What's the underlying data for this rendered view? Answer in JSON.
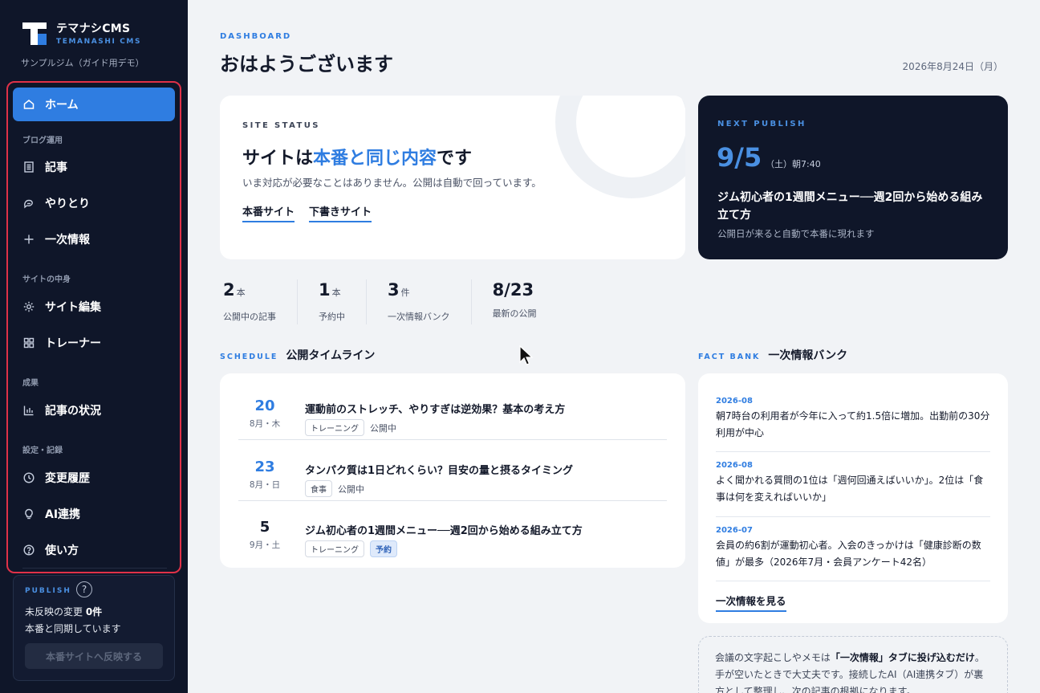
{
  "brand": {
    "name": "テマナシCMS",
    "sub": "TEMANASHI CMS",
    "site_name": "サンプルジム（ガイド用デモ）"
  },
  "sidebar": {
    "home": "ホーム",
    "groups": [
      "ブログ運用",
      "サイトの中身",
      "成果",
      "設定・記録"
    ],
    "items": [
      {
        "label": "記事",
        "icon": "document-icon"
      },
      {
        "label": "やりとり",
        "icon": "chat-icon"
      },
      {
        "label": "一次情報",
        "icon": "plus-icon"
      },
      {
        "label": "サイト編集",
        "icon": "gear-icon"
      },
      {
        "label": "トレーナー",
        "icon": "grid-icon"
      },
      {
        "label": "記事の状況",
        "icon": "bar-chart-icon"
      },
      {
        "label": "変更履歴",
        "icon": "clock-icon"
      },
      {
        "label": "AI連携",
        "icon": "lightbulb-icon"
      },
      {
        "label": "使い方",
        "icon": "help-icon"
      }
    ],
    "accent_color": "#2f7de1",
    "highlight_frame_color": "#e03148"
  },
  "publish": {
    "label": "PUBLISH",
    "help": "?",
    "pending_prefix": "未反映の変更 ",
    "pending_count": "0件",
    "sync_status": "本番と同期しています",
    "button": "本番サイトへ反映する"
  },
  "header": {
    "eyebrow": "DASHBOARD",
    "greeting": "おはようございます",
    "date": "2026年8月24日（月）"
  },
  "site_status": {
    "eyebrow": "SITE STATUS",
    "title_pre": "サイトは",
    "title_hl": "本番と同じ内容",
    "title_post": "です",
    "desc": "いま対応が必要なことはありません。公開は自動で回っています。",
    "link_prod": "本番サイト",
    "link_draft": "下書きサイト"
  },
  "next_publish": {
    "eyebrow": "NEXT PUBLISH",
    "date": "9/5",
    "when": "（土）朝7:40",
    "title": "ジム初心者の1週間メニュー──週2回から始める組み立て方",
    "note": "公開日が来ると自動で本番に現れます"
  },
  "stats": [
    {
      "num": "2",
      "unit": "本",
      "label": "公開中の記事"
    },
    {
      "num": "1",
      "unit": "本",
      "label": "予約中"
    },
    {
      "num": "3",
      "unit": "件",
      "label": "一次情報バンク"
    },
    {
      "num": "8/23",
      "unit": "",
      "label": "最新の公開"
    }
  ],
  "schedule": {
    "eyebrow": "SCHEDULE",
    "title": "公開タイムライン",
    "rows": [
      {
        "day": "20",
        "md": "8月・木",
        "title": "運動前のストレッチ、やりすぎは逆効果？基本の考え方",
        "tag": "トレーニング",
        "state": "公開中"
      },
      {
        "day": "23",
        "md": "8月・日",
        "title": "タンパク質は1日どれくらい？目安の量と摂るタイミング",
        "tag": "食事",
        "state": "公開中"
      },
      {
        "day": "5",
        "md": "9月・土",
        "title": "ジム初心者の1週間メニュー──週2回から始める組み立て方",
        "tag": "トレーニング",
        "state": "予約"
      }
    ]
  },
  "fact_bank": {
    "eyebrow": "FACT BANK",
    "title": "一次情報バンク",
    "facts": [
      {
        "date": "2026-08",
        "text": "朝7時台の利用者が今年に入って約1.5倍に増加。出勤前の30分利用が中心"
      },
      {
        "date": "2026-08",
        "text": "よく聞かれる質問の1位は「週何回通えばいいか」。2位は「食事は何を変えればいいか」"
      },
      {
        "date": "2026-07",
        "text": "会員の約6割が運動初心者。入会のきっかけは「健康診断の数値」が最多（2026年7月・会員アンケート42名）"
      }
    ],
    "link": "一次情報を見る"
  },
  "tip": {
    "pre": "会議の文字起こしやメモは",
    "bold": "「一次情報」タブに投げ込むだけ",
    "post": "。手が空いたときで大丈夫です。接続したAI（AI連携タブ）が裏方として整理し、次の記事の根拠になります。"
  }
}
